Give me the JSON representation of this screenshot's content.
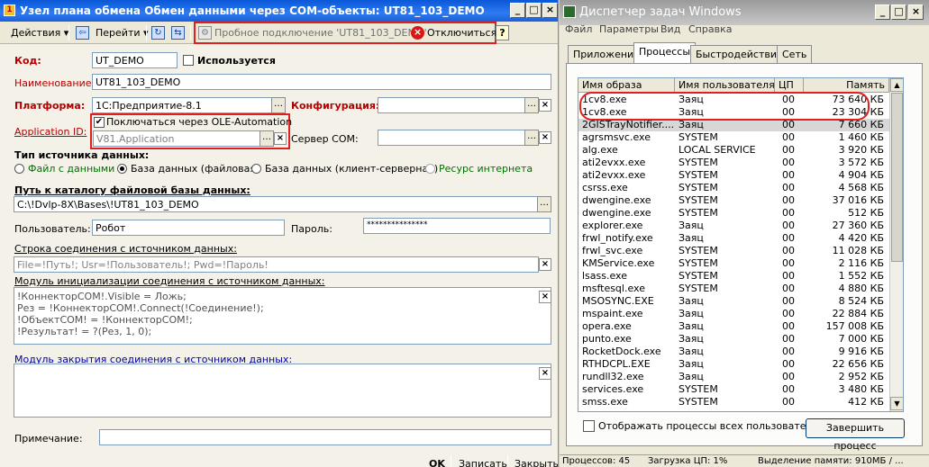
{
  "left_window": {
    "title": "Узел плана обмена Обмен данными через COM-объекты: UT81_103_DEMO",
    "toolbar": {
      "actions": "Действия",
      "goto": "Перейти",
      "test_connection": "Пробное подключение 'UT81_103_DEMO'",
      "disconnect": "Отключиться",
      "help": "?"
    },
    "form": {
      "code_label": "Код:",
      "code_value": "UT_DEMO",
      "used_label": "Используется",
      "name_label": "Наименование:",
      "name_value": "UT81_103_DEMO",
      "platform_label": "Платформа:",
      "platform_value": "1С:Предприятие-8.1",
      "config_label": "Конфигурация:",
      "config_value": "",
      "app_id_label": "Application ID:",
      "ole_checkbox": "Поключаться через OLE-Automation",
      "app_id_value": "V81.Application",
      "com_server_label": "Сервер COM:",
      "com_server_value": "",
      "source_type_label": "Тип источника данных:",
      "radio_files": "Файл с данными",
      "radio_db_file": "База данных (файловая)",
      "radio_db_server": "База данных (клиент-серверная)",
      "radio_web": "Ресурс интернета",
      "db_path_label": "Путь к каталогу файловой базы данных:",
      "db_path_value": "C:\\!Dvlp-8X\\Bases\\!UT81_103_DEMO",
      "user_label": "Пользователь:",
      "user_value": "Робот",
      "password_label": "Пароль:",
      "password_value": "***************",
      "conn_string_label": "Строка соединения с источником данных:",
      "conn_string_value": "File=!Путь!; Usr=!Пользователь!; Pwd=!Пароль!",
      "init_module_label": "Модуль инициализации соединения с источником данных:",
      "init_module_value": "!КоннекторCOM!.Visible = Ложь;\nРез = !КоннекторCOM!.Connect(!Соединение!);\n!ОбъектCOM! = !КоннекторCOM!;\n!Результат! = ?(Рез, 1, 0);",
      "close_module_label": "Модуль закрытия соединения с источником данных:",
      "close_module_value": "",
      "note_label": "Примечание:",
      "note_value": ""
    },
    "bottom": {
      "ok": "OK",
      "save": "Записать",
      "close": "Закрыть"
    }
  },
  "task_manager": {
    "title": "Диспетчер задач Windows",
    "menu": [
      "Файл",
      "Параметры",
      "Вид",
      "Справка"
    ],
    "tabs": [
      "Приложения",
      "Процессы",
      "Быстродействие",
      "Сеть"
    ],
    "active_tab": "Процессы",
    "columns": [
      "Имя образа",
      "Имя пользователя",
      "ЦП",
      "Память"
    ],
    "processes": [
      [
        "1cv8.exe",
        "Заяц",
        "00",
        "73 640 КБ"
      ],
      [
        "1cv8.exe",
        "Заяц",
        "00",
        "23 304 КБ"
      ],
      [
        "2GISTrayNotifier....",
        "Заяц",
        "00",
        "7 660 КБ"
      ],
      [
        "agrsmsvc.exe",
        "SYSTEM",
        "00",
        "1 460 КБ"
      ],
      [
        "alg.exe",
        "LOCAL SERVICE",
        "00",
        "3 920 КБ"
      ],
      [
        "ati2evxx.exe",
        "SYSTEM",
        "00",
        "3 572 КБ"
      ],
      [
        "ati2evxx.exe",
        "SYSTEM",
        "00",
        "4 904 КБ"
      ],
      [
        "csrss.exe",
        "SYSTEM",
        "00",
        "4 568 КБ"
      ],
      [
        "dwengine.exe",
        "SYSTEM",
        "00",
        "37 016 КБ"
      ],
      [
        "dwengine.exe",
        "SYSTEM",
        "00",
        "512 КБ"
      ],
      [
        "explorer.exe",
        "Заяц",
        "00",
        "27 360 КБ"
      ],
      [
        "frwl_notify.exe",
        "Заяц",
        "00",
        "4 420 КБ"
      ],
      [
        "frwl_svc.exe",
        "SYSTEM",
        "00",
        "11 028 КБ"
      ],
      [
        "KMService.exe",
        "SYSTEM",
        "00",
        "2 116 КБ"
      ],
      [
        "lsass.exe",
        "SYSTEM",
        "00",
        "1 552 КБ"
      ],
      [
        "msftesql.exe",
        "SYSTEM",
        "00",
        "4 880 КБ"
      ],
      [
        "MSOSYNC.EXE",
        "Заяц",
        "00",
        "8 524 КБ"
      ],
      [
        "mspaint.exe",
        "Заяц",
        "00",
        "22 884 КБ"
      ],
      [
        "opera.exe",
        "Заяц",
        "00",
        "157 008 КБ"
      ],
      [
        "punto.exe",
        "Заяц",
        "00",
        "7 000 КБ"
      ],
      [
        "RocketDock.exe",
        "Заяц",
        "00",
        "9 916 КБ"
      ],
      [
        "RTHDCPL.EXE",
        "Заяц",
        "00",
        "22 656 КБ"
      ],
      [
        "rundll32.exe",
        "Заяц",
        "00",
        "2 952 КБ"
      ],
      [
        "services.exe",
        "SYSTEM",
        "00",
        "3 480 КБ"
      ],
      [
        "smss.exe",
        "SYSTEM",
        "00",
        "412 КБ"
      ]
    ],
    "show_all_label": "Отображать процессы всех пользователей",
    "end_process": "Завершить процесс",
    "status": {
      "processes": "Процессов: 45",
      "cpu": "Загрузка ЦП: 1%",
      "commit": "Выделение памяти: 910МБ / ..."
    },
    "colors": {
      "highlight": "#e02020"
    }
  }
}
